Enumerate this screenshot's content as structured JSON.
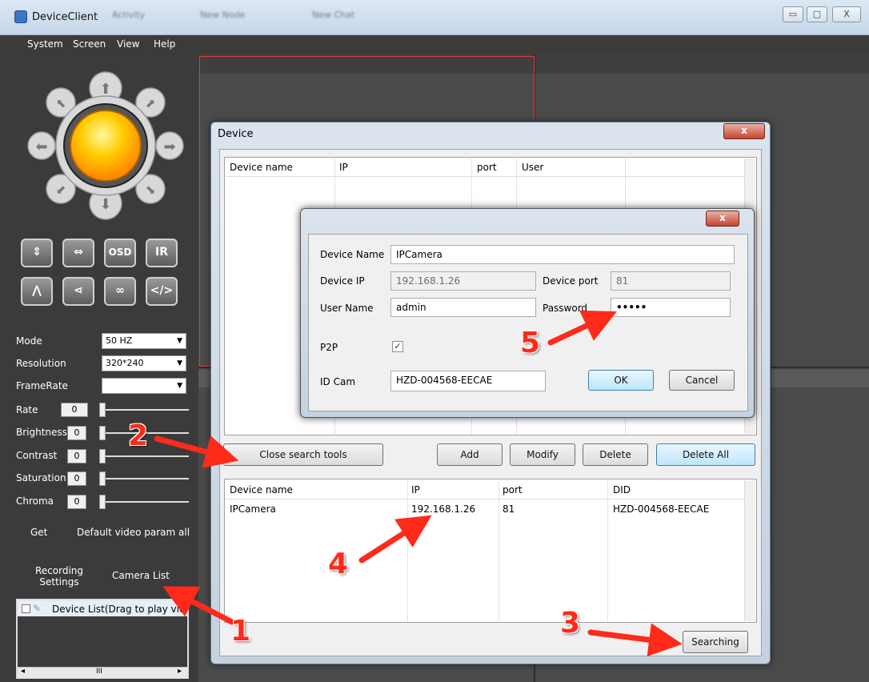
{
  "window": {
    "title": "DeviceClient",
    "tabs": [
      "Activity",
      "New Node",
      "New Chat"
    ],
    "controls": {
      "minimize": "▭",
      "maximize": "▢",
      "close": "X"
    }
  },
  "menu": [
    "System",
    "Screen",
    "View",
    "Help"
  ],
  "sidebar": {
    "ptz_buttons_row1": [
      "⇕",
      "⇔",
      "OSD",
      "IR"
    ],
    "ptz_buttons_row2": [
      "⋀",
      "⋖",
      "∞",
      "</>"
    ],
    "mode_label": "Mode",
    "mode_value": "50 HZ",
    "resolution_label": "Resolution",
    "resolution_value": "320*240",
    "framerate_label": "FrameRate",
    "framerate_value": "",
    "rate_label": "Rate",
    "rate_value": "0",
    "brightness_label": "Brightness",
    "brightness_value": "0",
    "contrast_label": "Contrast",
    "contrast_value": "0",
    "saturation_label": "Saturation",
    "saturation_value": "0",
    "chroma_label": "Chroma",
    "chroma_value": "0",
    "get_label": "Get",
    "default_label": "Default video param all",
    "recording_settings": "Recording Settings",
    "camera_list": "Camera List",
    "device_list_item": "Device List(Drag to play video)",
    "scroll_mid": "III"
  },
  "device_dialog": {
    "title": "Device",
    "close": "x",
    "search_headers": [
      "Device name",
      "IP",
      "port",
      "User"
    ],
    "buttons": {
      "close_search": "Close search tools",
      "add": "Add",
      "modify": "Modify",
      "delete": "Delete",
      "delete_all": "Delete All",
      "searching": "Searching"
    },
    "list_headers": [
      "Device name",
      "IP",
      "port",
      "DID"
    ],
    "list_row": {
      "name": "IPCamera",
      "ip": "192.168.1.26",
      "port": "81",
      "did": "HZD-004568-EECAE"
    }
  },
  "edit_dialog": {
    "close": "x",
    "device_name_label": "Device Name",
    "device_name": "IPCamera",
    "device_ip_label": "Device IP",
    "device_ip": "192.168.1.26",
    "device_port_label": "Device port",
    "device_port": "81",
    "user_name_label": "User Name",
    "user_name": "admin",
    "password_label": "Password",
    "password": "•••••",
    "p2p_label": "P2P",
    "p2p_checked": true,
    "id_cam_label": "ID Cam",
    "id_cam": "HZD-004568-EECAE",
    "ok": "OK",
    "cancel": "Cancel"
  },
  "annotations": [
    "1",
    "2",
    "3",
    "4",
    "5"
  ],
  "colors": {
    "annotation": "#ff2a1a",
    "sidebar_bg": "#3b3b3b",
    "video_bg": "#4a4a4a"
  }
}
